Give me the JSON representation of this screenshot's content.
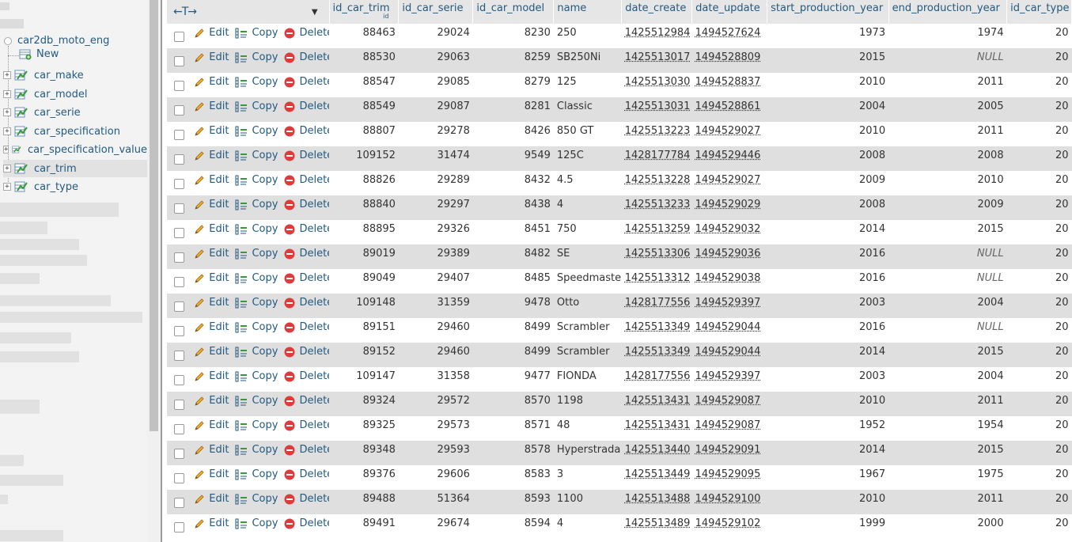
{
  "navigation": {
    "database": "car2db_moto_eng",
    "new_label": "New",
    "tables": [
      {
        "label": "car_make"
      },
      {
        "label": "car_model"
      },
      {
        "label": "car_serie"
      },
      {
        "label": "car_specification"
      },
      {
        "label": "car_specification_value"
      },
      {
        "label": "car_trim",
        "active": true
      },
      {
        "label": "car_type"
      }
    ],
    "expand_symbol": "+"
  },
  "table": {
    "options_arrows": "←T→",
    "dropdown_symbol": "▼",
    "sort_indicator": "id",
    "columns": [
      "id_car_trim",
      "id_car_serie",
      "id_car_model",
      "name",
      "date_create",
      "date_update",
      "start_production_year",
      "end_production_year",
      "id_car_type"
    ],
    "actions": {
      "edit": "Edit",
      "copy": "Copy",
      "delete": "Delete"
    },
    "rows": [
      [
        "88463",
        "29024",
        "8230",
        "250",
        "1425512984",
        "1494527624",
        "1973",
        "1974",
        "20"
      ],
      [
        "88530",
        "29063",
        "8259",
        "SB250Ni",
        "1425513017",
        "1494528809",
        "2015",
        "NULL",
        "20"
      ],
      [
        "88547",
        "29085",
        "8279",
        "125",
        "1425513030",
        "1494528837",
        "2010",
        "2011",
        "20"
      ],
      [
        "88549",
        "29087",
        "8281",
        "Classic",
        "1425513031",
        "1494528861",
        "2004",
        "2005",
        "20"
      ],
      [
        "88807",
        "29278",
        "8426",
        "850 GT",
        "1425513223",
        "1494529027",
        "2010",
        "2011",
        "20"
      ],
      [
        "109152",
        "31474",
        "9549",
        "125C",
        "1428177784",
        "1494529446",
        "2008",
        "2008",
        "20"
      ],
      [
        "88826",
        "29289",
        "8432",
        "4.5",
        "1425513228",
        "1494529027",
        "2009",
        "2010",
        "20"
      ],
      [
        "88840",
        "29297",
        "8438",
        "4",
        "1425513233",
        "1494529029",
        "2008",
        "2009",
        "20"
      ],
      [
        "88895",
        "29326",
        "8451",
        "750",
        "1425513259",
        "1494529032",
        "2014",
        "2015",
        "20"
      ],
      [
        "89019",
        "29389",
        "8482",
        "SE",
        "1425513306",
        "1494529036",
        "2016",
        "NULL",
        "20"
      ],
      [
        "89049",
        "29407",
        "8485",
        "Speedmaster",
        "1425513312",
        "1494529038",
        "2016",
        "NULL",
        "20"
      ],
      [
        "109148",
        "31359",
        "9478",
        "Otto",
        "1428177556",
        "1494529397",
        "2003",
        "2004",
        "20"
      ],
      [
        "89151",
        "29460",
        "8499",
        "Scrambler",
        "1425513349",
        "1494529044",
        "2016",
        "NULL",
        "20"
      ],
      [
        "89152",
        "29460",
        "8499",
        "Scrambler",
        "1425513349",
        "1494529044",
        "2014",
        "2015",
        "20"
      ],
      [
        "109147",
        "31358",
        "9477",
        "FIONDA",
        "1428177556",
        "1494529397",
        "2003",
        "2004",
        "20"
      ],
      [
        "89324",
        "29572",
        "8570",
        "1198",
        "1425513431",
        "1494529087",
        "2010",
        "2011",
        "20"
      ],
      [
        "89325",
        "29573",
        "8571",
        "48",
        "1425513431",
        "1494529087",
        "1952",
        "1954",
        "20"
      ],
      [
        "89348",
        "29593",
        "8578",
        "Hyperstrada",
        "1425513440",
        "1494529091",
        "2014",
        "2015",
        "20"
      ],
      [
        "89376",
        "29606",
        "8583",
        "3",
        "1425513449",
        "1494529095",
        "1967",
        "1975",
        "20"
      ],
      [
        "89488",
        "51364",
        "8593",
        "1100",
        "1425513488",
        "1494529100",
        "2010",
        "2011",
        "20"
      ],
      [
        "89491",
        "29674",
        "8594",
        "4",
        "1425513489",
        "1494529102",
        "1999",
        "2000",
        "20"
      ]
    ]
  }
}
